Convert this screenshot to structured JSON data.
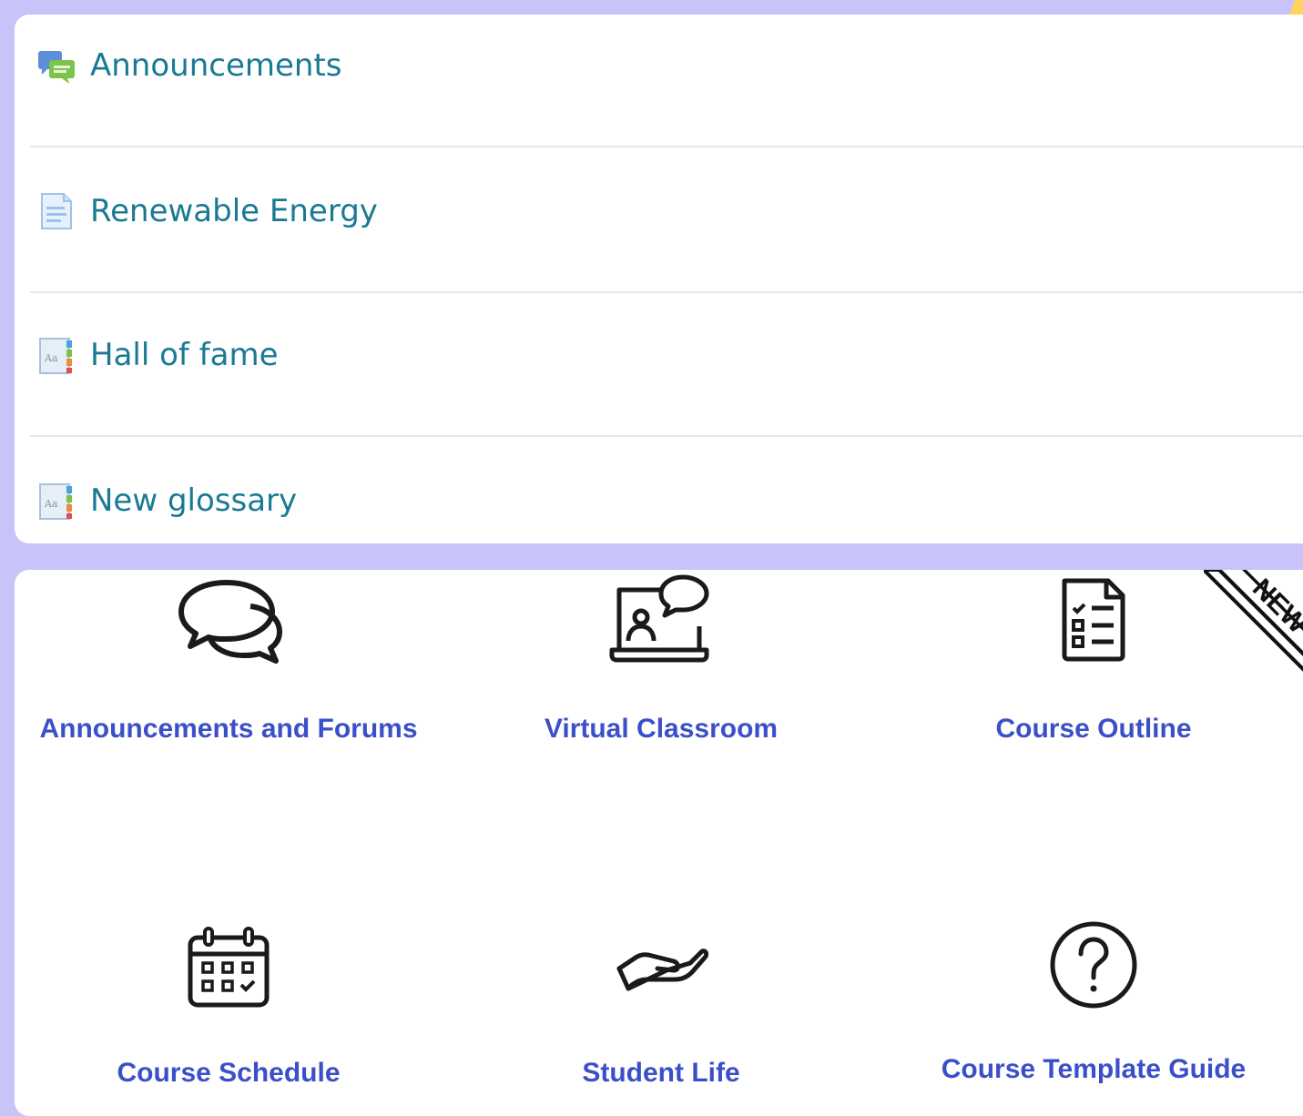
{
  "activities": [
    {
      "label": "Announcements",
      "icon": "forum-icon"
    },
    {
      "label": "Renewable Energy",
      "icon": "page-icon"
    },
    {
      "label": "Hall of fame",
      "icon": "glossary-icon"
    },
    {
      "label": "New glossary",
      "icon": "glossary-icon"
    }
  ],
  "tiles": [
    {
      "label": "Announcements and Forums",
      "icon": "chat-bubbles-icon"
    },
    {
      "label": "Virtual Classroom",
      "icon": "laptop-video-chat-icon"
    },
    {
      "label": "Course Outline",
      "icon": "checklist-document-icon",
      "badge": "NEW"
    },
    {
      "label": "Course Schedule",
      "icon": "calendar-icon"
    },
    {
      "label": "Student Life",
      "icon": "helping-hand-icon"
    },
    {
      "label": "Course Template Guide",
      "icon": "question-circle-icon"
    }
  ],
  "colors": {
    "background": "#c8c4fa",
    "activity_link": "#1a7a93",
    "tile_link": "#3b50c8",
    "star": "#ffd35c"
  }
}
